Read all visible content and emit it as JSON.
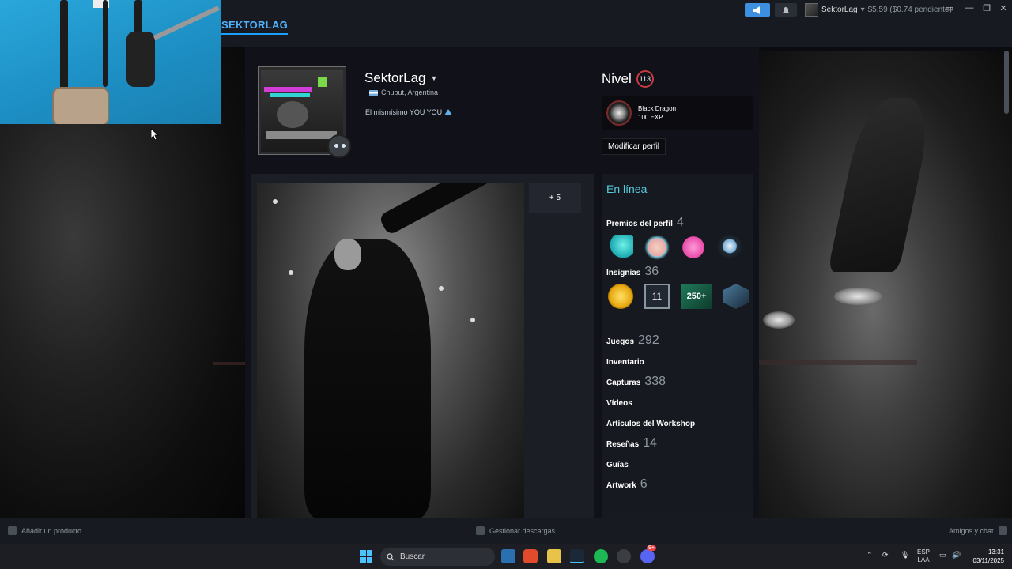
{
  "topbar": {
    "nav_title": "SEKTORLAG",
    "username": "SektorLag",
    "wallet": "$5.59 ($0.74 pendiente)"
  },
  "profile": {
    "name": "SektorLag",
    "location": "Chubut, Argentina",
    "summary": "El mismísimo YOU YOU",
    "level_label": "Nivel",
    "level": "113",
    "badge_name": "Black Dragon",
    "badge_exp": "100 EXP",
    "edit_button": "Modificar perfil",
    "showcase_more": "+ 5"
  },
  "sidebar": {
    "status": "En línea",
    "awards_label": "Premios del perfil",
    "awards_count": "4",
    "badges_label": "Insignias",
    "badges_count": "36",
    "badge_tile_11": "11",
    "badge_tile_250": "250+",
    "items": [
      {
        "label": "Juegos",
        "count": "292"
      },
      {
        "label": "Inventario",
        "count": ""
      },
      {
        "label": "Capturas",
        "count": "338"
      },
      {
        "label": "Vídeos",
        "count": ""
      },
      {
        "label": "Artículos del Workshop",
        "count": ""
      },
      {
        "label": "Reseñas",
        "count": "14"
      },
      {
        "label": "Guías",
        "count": ""
      },
      {
        "label": "Artwork",
        "count": "6"
      }
    ]
  },
  "bottombar": {
    "add_product": "Añadir un producto",
    "manage_downloads": "Gestionar descargas",
    "friends_chat": "Amigos y chat"
  },
  "taskbar": {
    "search_placeholder": "Buscar",
    "lang_top": "ESP",
    "lang_bottom": "LAA",
    "time": "13:31",
    "date": "03/11/2025",
    "discord_badge": "9+"
  },
  "colors": {
    "accent": "#1a9fff",
    "online": "#57cbde",
    "level_ring": "#c9393f"
  }
}
